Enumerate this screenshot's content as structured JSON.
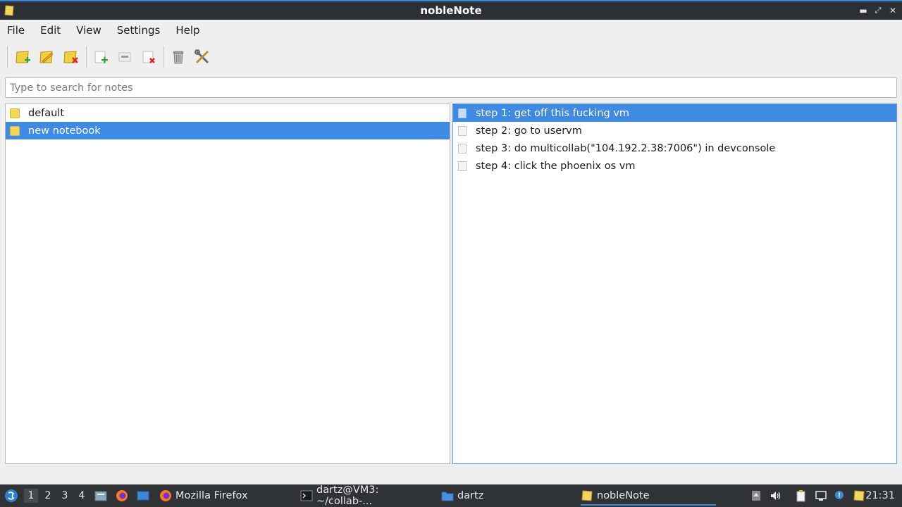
{
  "window": {
    "title": "nobleNote",
    "controls": [
      "minimize-icon",
      "restore-icon",
      "close-icon"
    ]
  },
  "menu": [
    "File",
    "Edit",
    "View",
    "Settings",
    "Help"
  ],
  "toolbar": {
    "buttons": [
      "new-notebook-icon",
      "rename-notebook-icon",
      "delete-notebook-icon",
      "new-note-icon",
      "rename-note-icon",
      "delete-note-icon",
      "trash-icon",
      "settings-tools-icon"
    ]
  },
  "search": {
    "placeholder": "Type to search for notes",
    "value": ""
  },
  "notebooks": [
    {
      "label": "default",
      "selected": false
    },
    {
      "label": "new notebook",
      "selected": true
    }
  ],
  "notes": [
    {
      "label": "step 1: get off this fucking vm",
      "selected": true
    },
    {
      "label": "step 2: go to uservm",
      "selected": false
    },
    {
      "label": "step 3: do multicollab(\"104.192.2.38:7006\") in devconsole",
      "selected": false
    },
    {
      "label": "step 4: click the phoenix os vm",
      "selected": false
    }
  ],
  "taskbar": {
    "desktops": [
      "1",
      "2",
      "3",
      "4"
    ],
    "active_desktop": "1",
    "tasks": [
      {
        "label": "Mozilla Firefox",
        "icon": "firefox-icon"
      },
      {
        "label": "dartz@VM3: ~/collab-...",
        "icon": "terminal-icon"
      },
      {
        "label": "dartz",
        "icon": "folder-icon"
      },
      {
        "label": "nobleNote",
        "icon": "noblenote-icon",
        "active": true
      }
    ],
    "clock": "21:31"
  },
  "colors": {
    "accent": "#3f8ae2",
    "titlebar": "#2c2f33",
    "taskbar": "#2f3336",
    "folder": "#f3d55b"
  }
}
